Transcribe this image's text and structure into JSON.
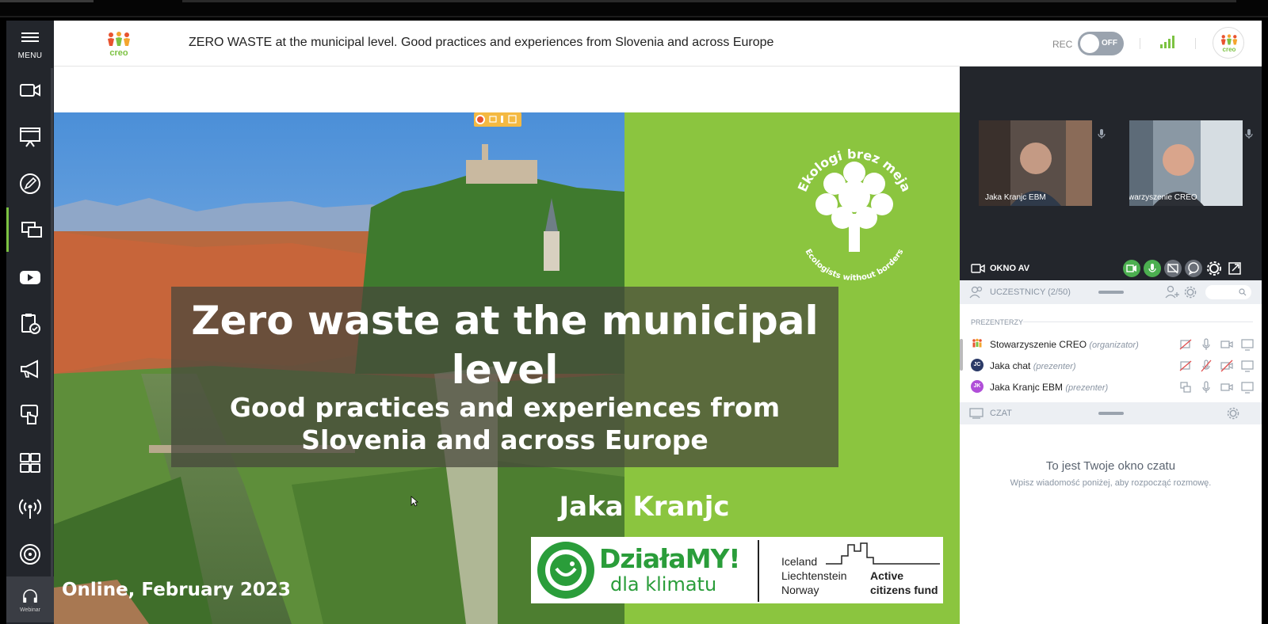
{
  "sidebar": {
    "menu_label": "MENU",
    "webinar_label": "Webinar"
  },
  "header": {
    "title": "ZERO WASTE at the municipal level. Good practices and experiences from Slovenia and across Europe",
    "rec_label": "REC",
    "rec_toggle": "OFF",
    "logo_text": "creo"
  },
  "slide": {
    "title": "Zero waste at the municipal level",
    "subtitle": "Good practices and experiences from Slovenia and across Europe",
    "author": "Jaka Kranjc",
    "date": "Online, February 2023",
    "org_name": "Ekologi brez meja",
    "org_tagline": "Ecologists without borders",
    "funding": {
      "program_line1": "DziałaMY!",
      "program_line2": "dla klimatu",
      "countries": [
        "Iceland",
        "Liechtenstein",
        "Norway"
      ],
      "fund_line1": "Active",
      "fund_line2": "citizens fund"
    }
  },
  "videos": [
    {
      "name": "Jaka Kranjc EBM"
    },
    {
      "name": "Stowarzyszenie CREO"
    }
  ],
  "av_window": {
    "label": "OKNO AV"
  },
  "participants": {
    "header": "UCZESTNICY (2/50)",
    "section_label": "PREZENTERZY",
    "people": [
      {
        "initials": "",
        "name": "Stowarzyszenie CREO",
        "role": "(organizator)",
        "color": "#ffffff"
      },
      {
        "initials": "JC",
        "name": "Jaka chat",
        "role": "(prezenter)",
        "color": "#2b3a67"
      },
      {
        "initials": "JK",
        "name": "Jaka Kranjc EBM",
        "role": "(prezenter)",
        "color": "#b04ed8"
      }
    ]
  },
  "chat": {
    "header": "CZAT",
    "empty_title": "To jest Twoje okno czatu",
    "empty_hint": "Wpisz wiadomość poniżej, aby rozpocząć rozmowę."
  },
  "colors": {
    "sidebar_bg": "#23262c",
    "accent_green": "#7cc242",
    "slide_green": "#8bc53f",
    "dzialamy_green": "#2a9d3a"
  }
}
